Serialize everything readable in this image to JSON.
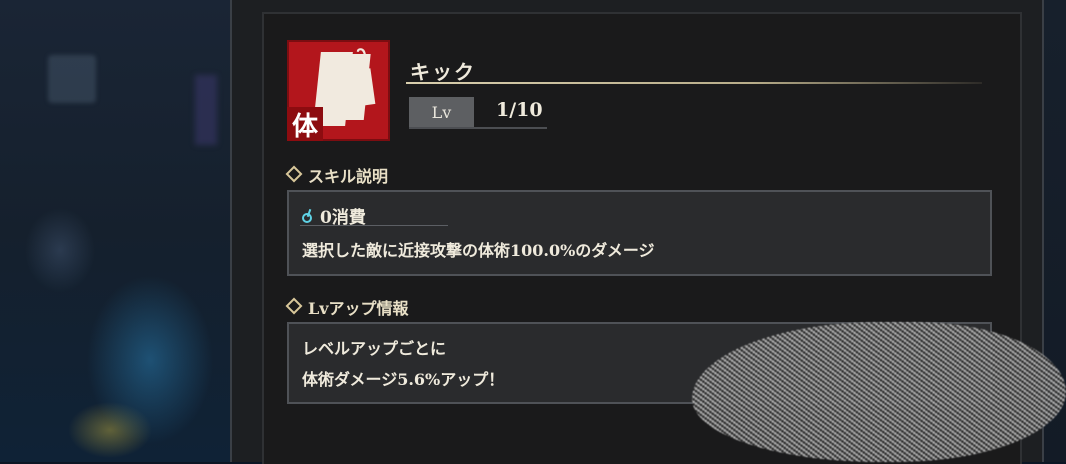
{
  "skill": {
    "name": "キック",
    "icon_tag": "体",
    "icon_mark": "Ꮚ",
    "level_label": "Lv",
    "level_value": "1/10"
  },
  "description": {
    "section_title": "スキル説明",
    "cost": "0消費",
    "text": "選択した敵に近接攻撃の体術100.0%のダメージ"
  },
  "levelup": {
    "section_title": "Lvアップ情報",
    "line1": "レベルアップごとに",
    "line2": "体術ダメージ5.6%アップ！"
  },
  "colors": {
    "icon_red": "#b3161c",
    "accent_gold": "#d8c79a",
    "mana_cyan": "#5fd3e6"
  }
}
